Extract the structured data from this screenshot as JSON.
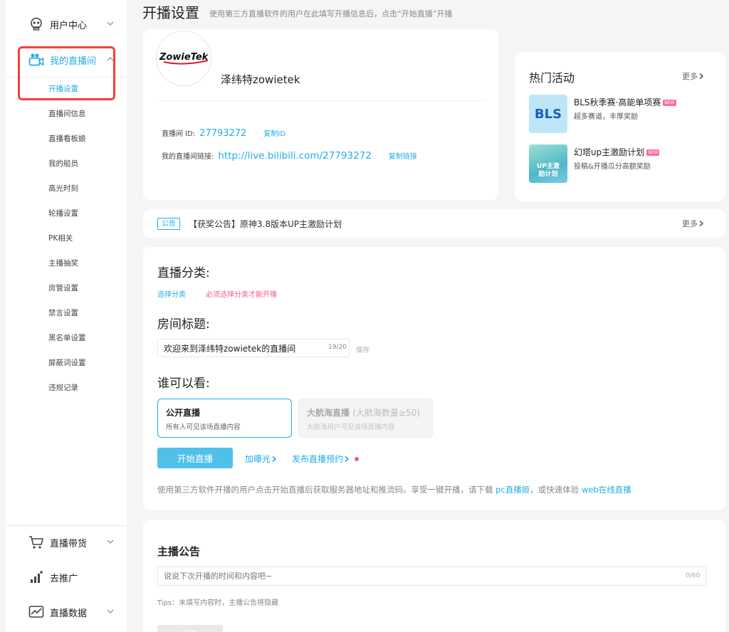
{
  "header": {
    "title": "开播设置",
    "desc": "使用第三方直播软件的用户在此填写开播信息后，点击“开始直播”开播"
  },
  "sidebar": {
    "groups": {
      "user_center": "用户中心",
      "my_room": "我的直播间",
      "live_goods": "直播带货",
      "promote": "去推广",
      "live_data": "直播数据"
    },
    "sub_items": [
      "开播设置",
      "直播间信息",
      "直播看板娘",
      "我的船员",
      "高光时刻",
      "轮播设置",
      "PK相关",
      "主播抽奖",
      "房管设置",
      "禁言设置",
      "黑名单设置",
      "屏蔽词设置",
      "违规记录"
    ]
  },
  "room": {
    "logo_text": "ZowieTek",
    "name": "泽纬特zowietek",
    "id_label": "直播间 ID:",
    "id_value": "27793272",
    "copy_id": "复制ID",
    "link_label": "我的直播间链接:",
    "link_value": "http://live.bilibili.com/27793272",
    "copy_link": "复制链接"
  },
  "hot": {
    "title": "热门活动",
    "more": "更多",
    "items": [
      {
        "thumb_text": "BLS",
        "name": "BLS秋季赛·高能单项赛",
        "badge": "NEW",
        "sub": "超多赛道，丰厚奖励"
      },
      {
        "thumb_text": "UP主激励计划",
        "name": "幻塔up主激励计划",
        "badge": "NEW",
        "sub": "投稿&开播瓜分高额奖励"
      }
    ]
  },
  "notice": {
    "tag": "公告",
    "text": "【获奖公告】原神3.8版本UP主激励计划",
    "more": "更多"
  },
  "settings": {
    "category_label": "直播分类:",
    "select_category": "选择分类",
    "must_select": "必须选择分类才能开播",
    "title_label": "房间标题:",
    "title_value": "欢迎来到泽纬特zowietek的直播间",
    "title_count": "19/20",
    "save": "保存",
    "who_label": "谁可以看:",
    "public_title": "公开直播",
    "public_desc": "所有人可见该场直播内容",
    "fleet_title": "大航海直播",
    "fleet_hint": "(大航海数量≥50)",
    "fleet_desc": "大航海用户可见该场直播内容",
    "start_btn": "开始直播",
    "boost": "加曝光",
    "schedule": "发布直播预约",
    "note_pre": "使用第三方软件开播的用户点击开始直播后获取服务器地址和推流码。享受一键开播，请下载 ",
    "note_link1": "pc直播姬",
    "note_mid": "，或快速体验 ",
    "note_link2": "web在线直播"
  },
  "announce": {
    "title": "主播公告",
    "placeholder": "说说下次开播的时间和内容吧~",
    "count": "0/60",
    "tips": "Tips：未填写内容时，主播公告将隐藏",
    "save": "保存"
  },
  "colors": {
    "accent": "#23ade5",
    "button": "#4fc1e9",
    "pink": "#f25d8e",
    "highlight": "#f2413b"
  }
}
